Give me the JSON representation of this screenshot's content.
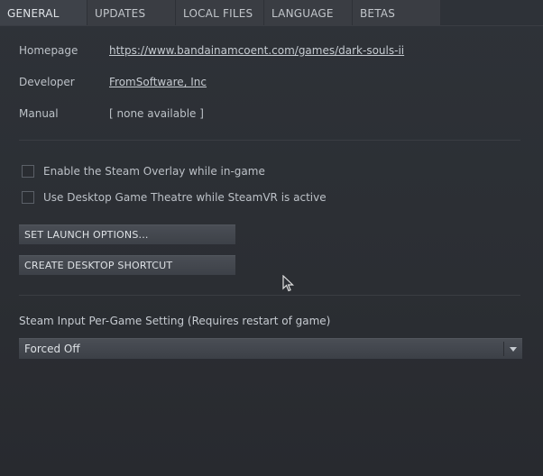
{
  "tabs": [
    {
      "label": "GENERAL"
    },
    {
      "label": "UPDATES"
    },
    {
      "label": "LOCAL FILES"
    },
    {
      "label": "LANGUAGE"
    },
    {
      "label": "BETAS"
    }
  ],
  "info": {
    "homepage_label": "Homepage",
    "homepage_value": "https://www.bandainamcoent.com/games/dark-souls-ii",
    "developer_label": "Developer",
    "developer_value": "FromSoftware, Inc",
    "manual_label": "Manual",
    "manual_value": "[ none available ]"
  },
  "options": {
    "overlay_label": "Enable the Steam Overlay while in-game",
    "theatre_label": "Use Desktop Game Theatre while SteamVR is active"
  },
  "buttons": {
    "launch_options": "SET LAUNCH OPTIONS...",
    "desktop_shortcut": "CREATE DESKTOP SHORTCUT"
  },
  "steam_input": {
    "label": "Steam Input Per-Game Setting (Requires restart of game)",
    "selected": "Forced Off"
  },
  "icons": {
    "dropdown": "chevron-down-icon",
    "cursor": "mouse-cursor-icon"
  }
}
